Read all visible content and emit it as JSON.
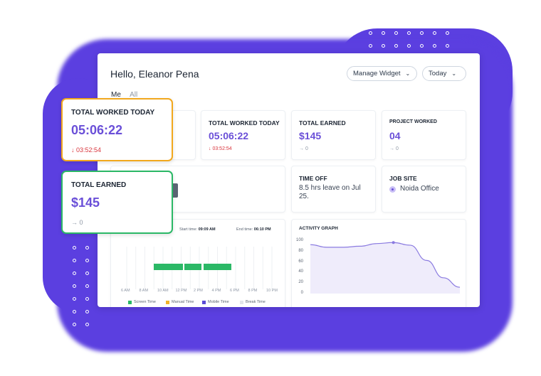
{
  "header": {
    "greeting": "Hello, Eleanor Pena",
    "manage_widget": "Manage Widget",
    "period": "Today"
  },
  "tabs": [
    {
      "label": "Me"
    },
    {
      "label": "All"
    }
  ],
  "cards": {
    "worked": {
      "label": "TOTAL WORKED TODAY",
      "value": "05:06:22",
      "delta": "↓ 03:52:54"
    },
    "earned": {
      "label": "TOTAL EARNED",
      "value": "$145",
      "delta": "→ 0"
    },
    "project": {
      "label": "PROJECT WORKED",
      "value": "04",
      "delta": "→ 0"
    },
    "time_off": {
      "label": "TIME OFF",
      "text": "8.5 hrs leave on Jul 25."
    },
    "job_site": {
      "label": "JOB SITE",
      "text": "Noida Office"
    }
  },
  "float_cards": {
    "worked": {
      "label": "TOTAL WORKED TODAY",
      "value": "05:06:22",
      "delta": "↓ 03:52:54"
    },
    "earned": {
      "label": "TOTAL EARNED",
      "value": "$145",
      "delta": "→ 0"
    }
  },
  "timeline": {
    "start_label": "Start time:",
    "start_value": "09:09 AM",
    "end_label": "End time:",
    "end_value": "06:10 PM",
    "ticks": [
      "6 AM",
      "8 AM",
      "10 AM",
      "12 PM",
      "2 PM",
      "4 PM",
      "6 PM",
      "8 PM",
      "10 PM"
    ],
    "legend": [
      {
        "name": "Screen Time",
        "color": "#2bb866"
      },
      {
        "name": "Manual Time",
        "color": "#f2b429"
      },
      {
        "name": "Mobile Time",
        "color": "#5b4bd5"
      },
      {
        "name": "Break Time",
        "color": "#e2e5ea"
      }
    ]
  },
  "chart_data": {
    "type": "area",
    "title": "ACTIVITY GRAPH",
    "ylim": [
      0,
      100
    ],
    "yticks": [
      100,
      80,
      60,
      40,
      20,
      0
    ],
    "values": [
      93,
      88,
      88,
      90,
      95,
      97,
      92,
      63,
      30,
      12
    ],
    "color": "#8a7ae0"
  },
  "colors": {
    "accent": "#6a4fd8",
    "background_blob": "#5b3fe0",
    "float_orange": "#f2a81d",
    "float_green": "#2bb866"
  }
}
